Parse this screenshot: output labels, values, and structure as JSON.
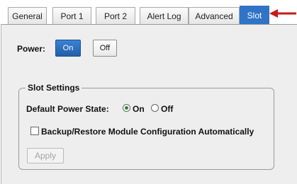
{
  "tabs": [
    {
      "label": "General"
    },
    {
      "label": "Port 1"
    },
    {
      "label": "Port 2"
    },
    {
      "label": "Alert Log"
    },
    {
      "label": "Advanced"
    },
    {
      "label": "Slot"
    }
  ],
  "active_tab": "Slot",
  "power": {
    "label": "Power:",
    "on_label": "On",
    "off_label": "Off"
  },
  "slot_settings": {
    "legend": "Slot Settings",
    "default_power_state_label": "Default Power State:",
    "option_on": "On",
    "option_off": "Off",
    "selected": "On",
    "backup_label": "Backup/Restore Module Configuration Automatically",
    "backup_checked": false,
    "apply_label": "Apply"
  },
  "colors": {
    "accent": "#2f74c6",
    "arrow": "#c81818",
    "panel_bg": "#eeeeee"
  }
}
